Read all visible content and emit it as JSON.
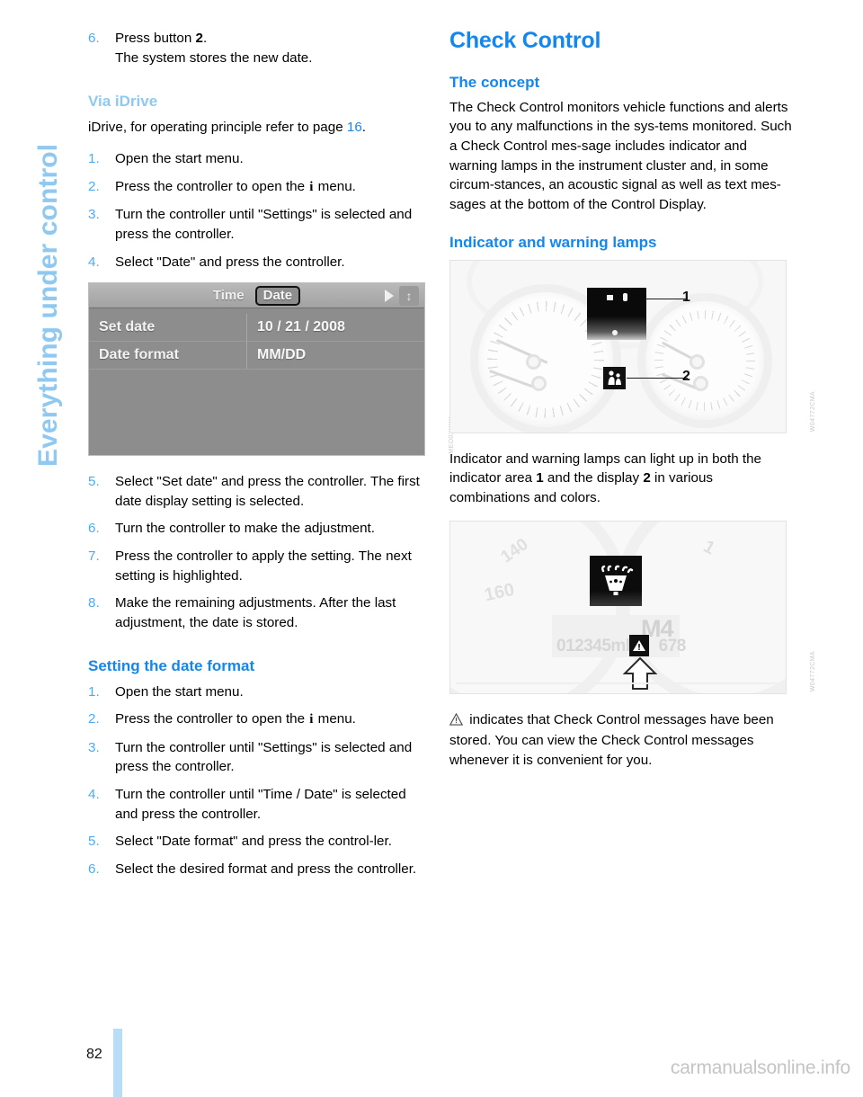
{
  "chapter": {
    "title": "Everything under control"
  },
  "footer": {
    "page_number": "82",
    "watermark": "carmanualsonline.info"
  },
  "left_column": {
    "step_6_continued": {
      "num": "6.",
      "line1_pre": "Press button ",
      "line1_bold": "2",
      "line1_post": ".",
      "line2": "The system stores the new date."
    },
    "via_idrive": {
      "heading": "Via iDrive",
      "intro_pre": "iDrive, for operating principle refer to page ",
      "intro_ref": "16",
      "intro_post": ".",
      "steps": [
        {
          "num": "1.",
          "text": "Open the start menu."
        },
        {
          "num": "2.",
          "pre": "Press the controller to open the ",
          "glyph": "i",
          "post": " menu."
        },
        {
          "num": "3.",
          "text": "Turn the controller until \"Settings\" is selected and press the controller."
        },
        {
          "num": "4.",
          "text": "Select \"Date\" and press the controller."
        }
      ]
    },
    "idrive_figure": {
      "tab_time": "Time",
      "tab_date": "Date",
      "rows": [
        {
          "label": "Set date",
          "value": "10 / 21 / 2008"
        },
        {
          "label": "Date format",
          "value": "MM/DD"
        }
      ],
      "credit": "MEO0XXXX"
    },
    "steps_after_figure": [
      {
        "num": "5.",
        "text": "Select \"Set date\" and press the controller. The first date display setting is selected."
      },
      {
        "num": "6.",
        "text": "Turn the controller to make the adjustment."
      },
      {
        "num": "7.",
        "text": "Press the controller to apply the setting. The next setting is highlighted."
      },
      {
        "num": "8.",
        "text": "Make the remaining adjustments. After the last adjustment, the date is stored."
      }
    ],
    "date_format": {
      "heading": "Setting the date format",
      "steps": [
        {
          "num": "1.",
          "text": "Open the start menu."
        },
        {
          "num": "2.",
          "pre": "Press the controller to open the ",
          "glyph": "i",
          "post": " menu."
        },
        {
          "num": "3.",
          "text": "Turn the controller until \"Settings\" is selected and press the controller."
        },
        {
          "num": "4.",
          "text": "Turn the controller until \"Time / Date\" is selected and press the controller."
        },
        {
          "num": "5.",
          "text": "Select \"Date format\" and press the control-ler."
        },
        {
          "num": "6.",
          "text": "Select the desired format and press the controller."
        }
      ]
    }
  },
  "right_column": {
    "title": "Check Control",
    "concept": {
      "heading": "The concept",
      "body": "The Check Control monitors vehicle functions and alerts you to any malfunctions in the sys-tems monitored. Such a Check Control mes-sage includes indicator and warning lamps in the instrument cluster and, in some circum-stances, an acoustic signal as well as text mes-sages at the bottom of the Control Display."
    },
    "lamps": {
      "heading": "Indicator and warning lamps",
      "cluster_figure": {
        "callout_1": "1",
        "callout_2": "2",
        "credit": "W04772CMA"
      },
      "caption_pre": "Indicator and warning lamps can light up in both the indicator area ",
      "caption_b1": "1",
      "caption_mid": " and the display ",
      "caption_b2": "2",
      "caption_post": " in various combinations and colors.",
      "closeup_figure": {
        "gear": "M4",
        "odometer": "012345mls",
        "odometer_trail": "678",
        "tick_140": "140",
        "tick_160": "160",
        "tick_r1": "1",
        "credit": "W04772CMA"
      },
      "warning_note_pre": " indicates that Check Control messages have been stored. You can view the Check Control messages whenever it is convenient for you."
    }
  },
  "colors": {
    "accent_blue": "#1487ee",
    "light_blue": "#8fc9f2",
    "step_blue": "#4eaaf5",
    "page_bar": "#b9ddf7"
  }
}
